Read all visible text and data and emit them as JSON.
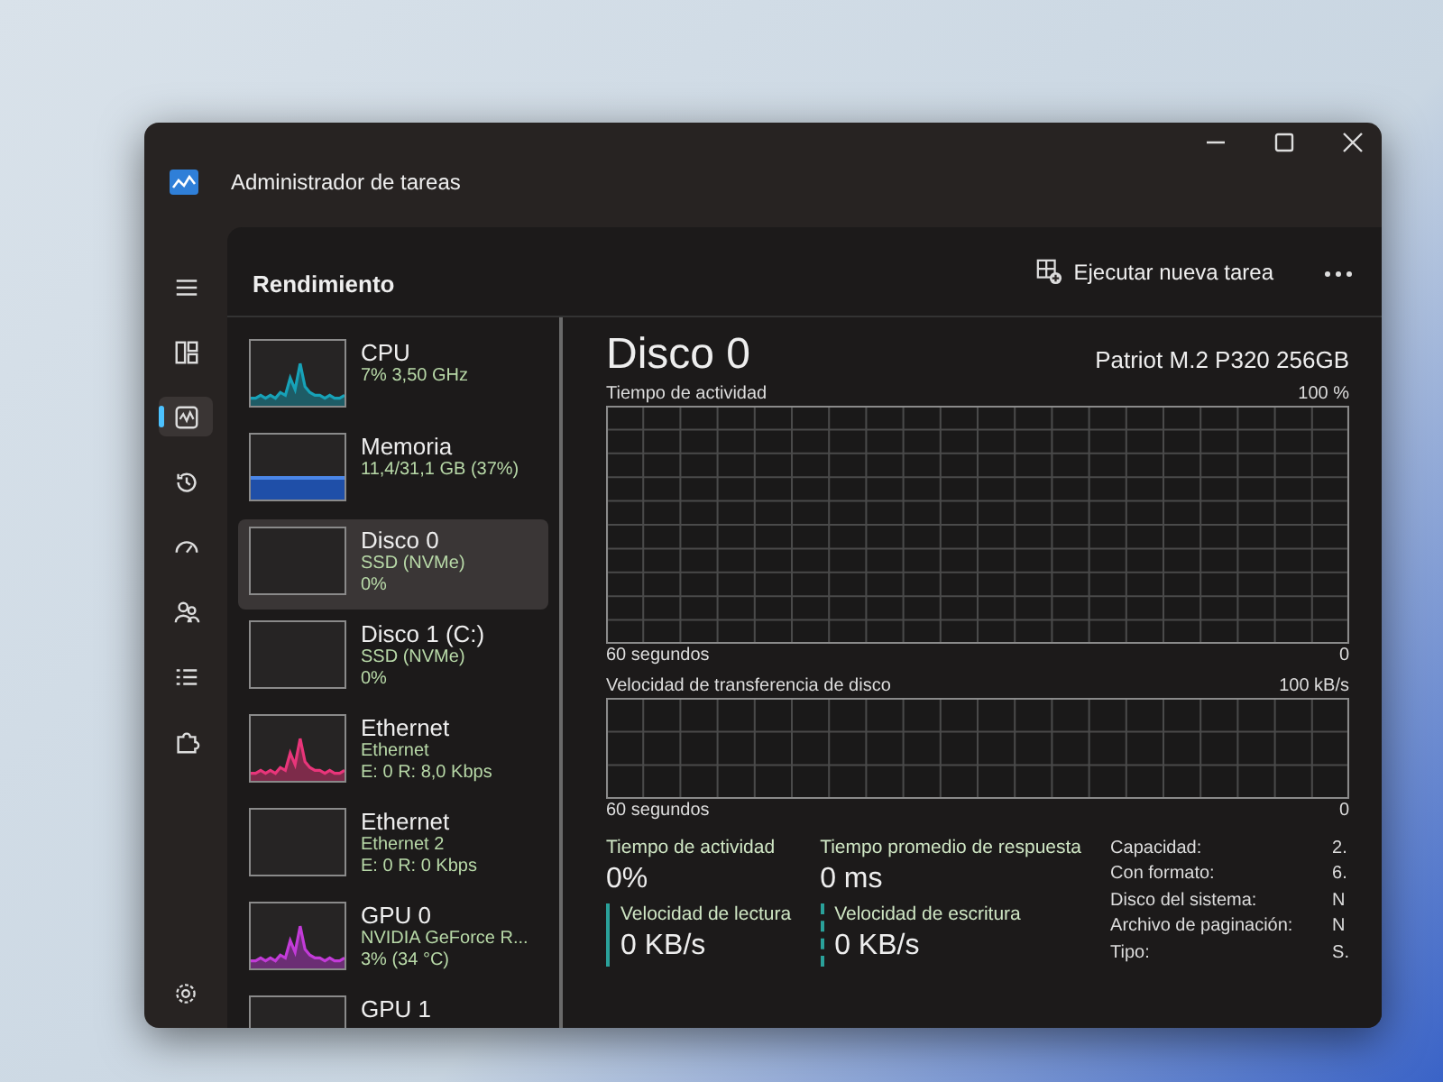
{
  "window": {
    "title": "Administrador de tareas"
  },
  "nav_items": [
    {
      "kind": "processes",
      "selected": false
    },
    {
      "kind": "performance",
      "selected": true
    },
    {
      "kind": "history",
      "selected": false
    },
    {
      "kind": "startup",
      "selected": false
    },
    {
      "kind": "users",
      "selected": false
    },
    {
      "kind": "details",
      "selected": false
    },
    {
      "kind": "services",
      "selected": false
    }
  ],
  "header": {
    "title": "Rendimiento",
    "run_task": "Ejecutar nueva tarea"
  },
  "devices": [
    {
      "name": "CPU",
      "line_1": "7% 3,50 GHz",
      "kind": "sparkline",
      "color": "#17a2b8",
      "selected": false
    },
    {
      "name": "Memoria",
      "line_1": "11,4/31,1 GB (37%)",
      "kind": "fill",
      "color": "#1f4fa8",
      "selected": false
    },
    {
      "name": "Disco 0",
      "line_1": "SSD (NVMe)",
      "line_2": "0%",
      "kind": "empty",
      "selected": true
    },
    {
      "name": "Disco 1 (C:)",
      "line_1": "SSD (NVMe)",
      "line_2": "0%",
      "kind": "empty",
      "selected": false
    },
    {
      "name": "Ethernet",
      "line_1": "Ethernet",
      "line_2": "E: 0 R: 8,0 Kbps",
      "kind": "sparkline",
      "color": "#e8357a",
      "selected": false
    },
    {
      "name": "Ethernet",
      "line_1": "Ethernet 2",
      "line_2": "E: 0 R: 0 Kbps",
      "kind": "empty",
      "selected": false
    },
    {
      "name": "GPU 0",
      "line_1": "NVIDIA GeForce R...",
      "line_2": "3% (34 °C)",
      "kind": "sparkline",
      "color": "#c23bd8",
      "selected": false
    },
    {
      "name": "GPU 1",
      "kind": "empty",
      "selected": false
    }
  ],
  "detail": {
    "title": "Disco 0",
    "model": "Patriot M.2 P320 256GB",
    "charts": [
      {
        "label": "Tiempo de actividad",
        "max": "100 %",
        "min": "0",
        "time": "60 segundos"
      },
      {
        "label": "Velocidad de transferencia de disco",
        "max": "100 kB/s",
        "min": "0",
        "time": "60 segundos"
      }
    ],
    "stats": [
      {
        "label": "Tiempo de actividad",
        "value": "0%",
        "kind": "plain"
      },
      {
        "label": "Tiempo promedio de respuesta",
        "value": "0 ms",
        "kind": "plain"
      },
      {
        "label": "Velocidad de lectura",
        "value": "0 KB/s",
        "kind": "solid"
      },
      {
        "label": "Velocidad de escritura",
        "value": "0 KB/s",
        "kind": "dashed"
      }
    ],
    "properties": [
      {
        "label": "Capacidad:",
        "value": "2."
      },
      {
        "label": "Con formato:",
        "value": "6."
      },
      {
        "label": "Disco del sistema:",
        "value": "N"
      },
      {
        "label": "Archivo de paginación:",
        "value": "N"
      },
      {
        "label": "Tipo:",
        "value": "S."
      }
    ]
  }
}
